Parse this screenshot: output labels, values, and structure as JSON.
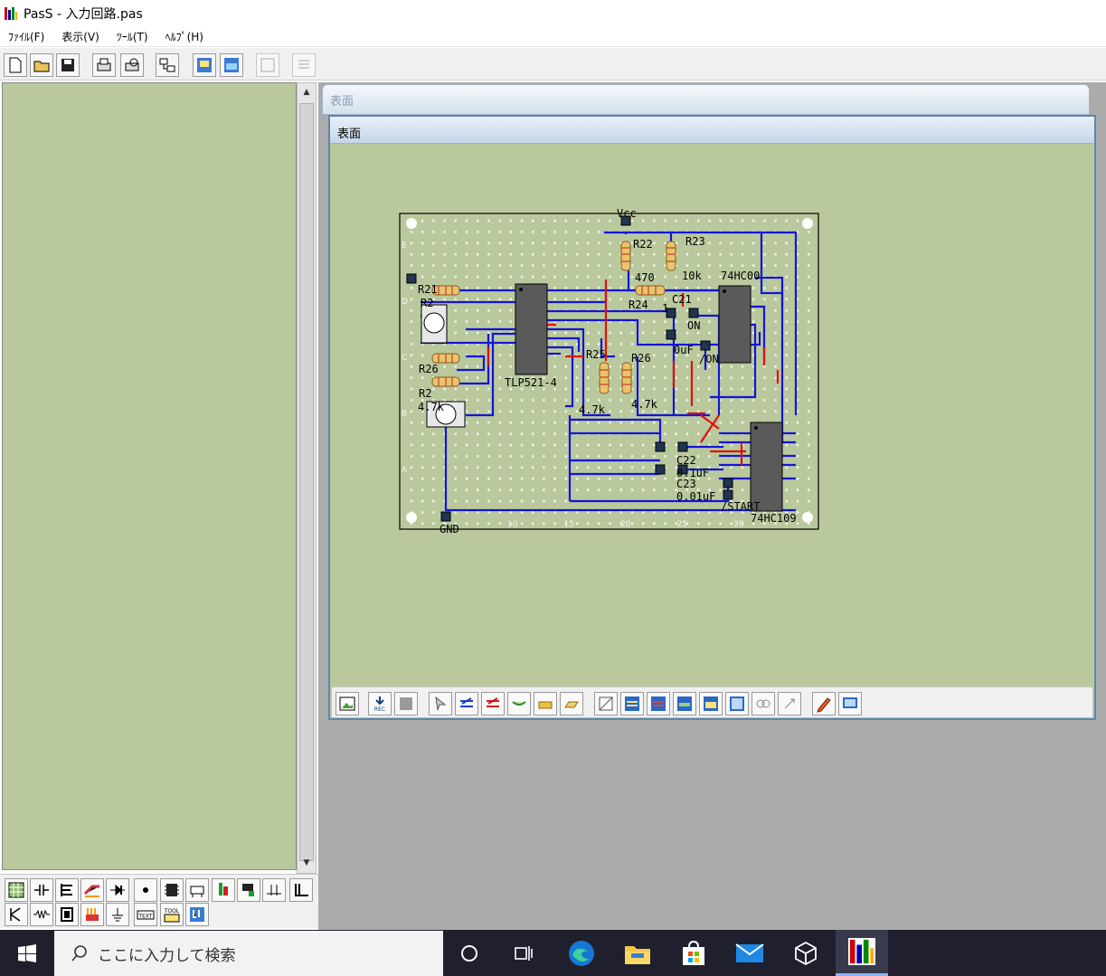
{
  "window": {
    "title": "PasS - 入力回路.pas",
    "app_icon": "pass-app-icon"
  },
  "menu": [
    "ﾌｧｲﾙ(F)",
    "表示(V)",
    "ﾂｰﾙ(T)",
    "ﾍﾙﾌﾟ(H)"
  ],
  "toolbar": {
    "buttons": [
      "new-file-icon",
      "open-folder-icon",
      "save-icon",
      "print-icon",
      "print-preview-icon",
      "parts-list-icon",
      "board-view-icon",
      "board-view2-icon",
      "netlist-icon",
      "report-icon"
    ]
  },
  "mdi": {
    "back_window_title": "表面",
    "front_window_title": "表面"
  },
  "board": {
    "labels": {
      "vcc": "Vcc",
      "gnd": "GND",
      "r22": "R22",
      "r23": "R23",
      "r24": "R24",
      "r25": "R25",
      "r26": "R26",
      "v470": "470",
      "v10k": "10k",
      "ic1": "74HC00",
      "ic2": "TLP521-4",
      "ic3": "74HC109",
      "c21": "C21",
      "c22": "C22",
      "c23": "C23",
      "c21v": "1",
      "c22v": "0.1uF",
      "c23v": "0.01uF",
      "on": "ON",
      "offlbl": "/ON",
      "ouf": "0uF",
      "r47k_a": "4.7k",
      "r47k_b": "4.7k",
      "start": "/START",
      "r21": "R21",
      "r22b": "R2",
      "r26b": "R26",
      "r2b": "R2",
      "r4": "4.7k",
      "r2c": "R21",
      "r2d": "R24"
    },
    "row_labels": [
      "E",
      "D",
      "C",
      "B",
      "A"
    ],
    "col_labels": [
      "10",
      "15",
      "20",
      "25",
      "30"
    ]
  },
  "search": {
    "placeholder": "ここに入力して検索"
  },
  "taskbar": {
    "items": [
      "cortana-icon",
      "task-view-icon",
      "edge-icon",
      "file-explorer-icon",
      "store-icon",
      "mail-icon",
      "3d-viewer-icon",
      "pass-app-icon"
    ]
  }
}
